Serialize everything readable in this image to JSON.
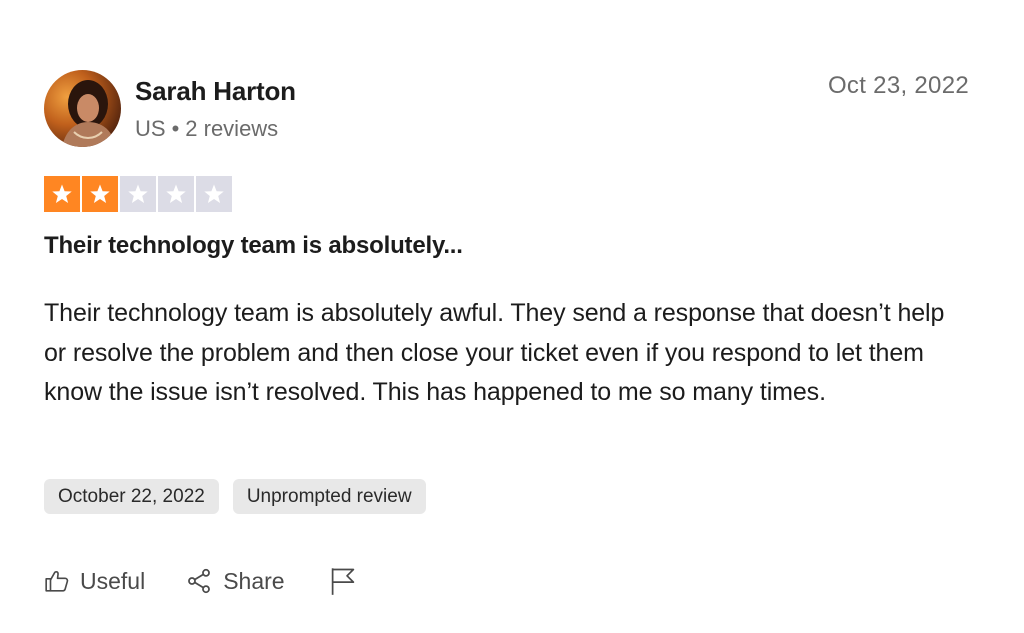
{
  "reviewer": {
    "name": "Sarah Harton",
    "country": "US",
    "separator": "•",
    "review_count": "2 reviews"
  },
  "review": {
    "date_posted": "Oct 23, 2022",
    "rating": 2,
    "rating_max": 5,
    "title": "Their technology team is absolutely...",
    "body": "Their technology team is absolutely awful. They send a response that doesn’t help or resolve the problem and then close your ticket even if you respond to let them know the issue isn’t resolved. This has happened to me so many times.",
    "tags": {
      "experience_date": "October 22, 2022",
      "review_type": "Unprompted review"
    }
  },
  "actions": {
    "useful_label": "Useful",
    "share_label": "Share",
    "flag_icon": "flag-icon"
  },
  "colors": {
    "star_filled": "#ff8622",
    "star_empty": "#dcdce6",
    "tag_background": "#e8e8e8",
    "muted_text": "#6b6b6b"
  }
}
